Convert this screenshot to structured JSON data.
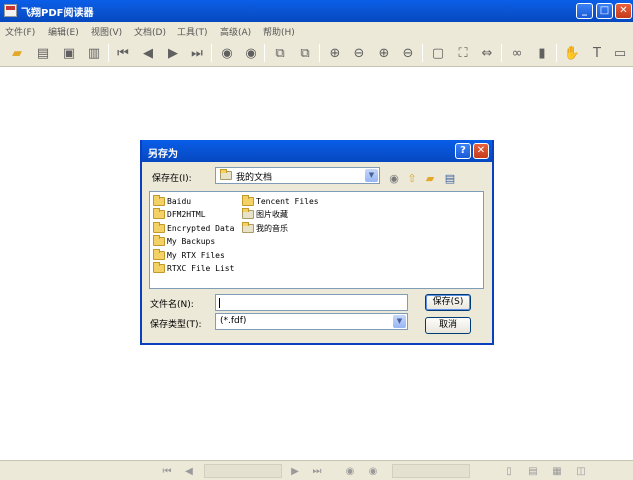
{
  "app": {
    "title": "飞翔PDF阅读器"
  },
  "window_buttons": {
    "minimize": "_",
    "maximize": "□",
    "close": "✕"
  },
  "menu": [
    "文件(F)",
    "编辑(E)",
    "视图(V)",
    "文档(D)",
    "工具(T)",
    "高级(A)",
    "帮助(H)"
  ],
  "toolbar_icons": [
    "open-folder-icon",
    "import-icon",
    "save-icon",
    "print-icon",
    "first-page-icon",
    "prev-page-icon",
    "next-page-icon",
    "last-page-icon",
    "back-icon",
    "forward-icon",
    "rotate-left-icon",
    "rotate-right-icon",
    "zoom-in-icon",
    "zoom-out-icon",
    "zoom-plus-icon",
    "zoom-minus-icon",
    "actual-size-icon",
    "fit-page-icon",
    "fit-width-icon",
    "find-icon",
    "bookmark-icon",
    "hand-tool-icon",
    "text-select-icon",
    "snapshot-icon"
  ],
  "dialog": {
    "title": "另存为",
    "help": "?",
    "close": "✕",
    "save_in_label": "保存在(I):",
    "save_in_value": "我的文档",
    "files_col1": [
      "Baidu",
      "DFM2HTML",
      "Encrypted Data",
      "My Backups",
      "My RTX Files",
      "RTXC File List"
    ],
    "files_col2": [
      "Tencent Files",
      "图片收藏",
      "我的音乐"
    ],
    "filename_label": "文件名(N):",
    "filename_value": "",
    "filetype_label": "保存类型(T):",
    "filetype_value": "(*.fdf)",
    "save_button": "保存(S)",
    "cancel_button": "取消"
  }
}
